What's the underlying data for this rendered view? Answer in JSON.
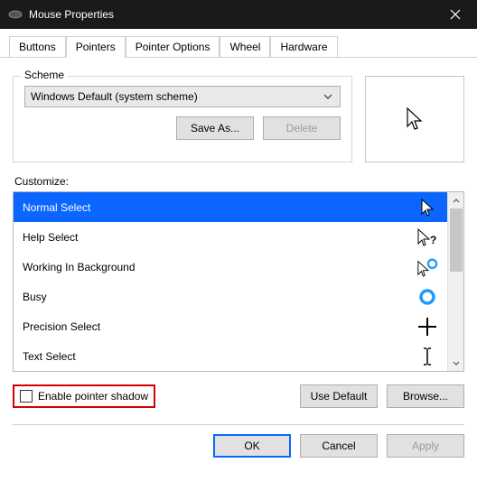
{
  "window": {
    "title": "Mouse Properties"
  },
  "tabs": {
    "buttons": "Buttons",
    "pointers": "Pointers",
    "pointer_options": "Pointer Options",
    "wheel": "Wheel",
    "hardware": "Hardware"
  },
  "scheme": {
    "legend": "Scheme",
    "selected": "Windows Default (system scheme)",
    "save_as": "Save As...",
    "delete": "Delete"
  },
  "customize_label": "Customize:",
  "cursors": {
    "normal_select": "Normal Select",
    "help_select": "Help Select",
    "working_bg": "Working In Background",
    "busy": "Busy",
    "precision": "Precision Select",
    "text": "Text Select"
  },
  "enable_shadow": "Enable pointer shadow",
  "use_default": "Use Default",
  "browse": "Browse...",
  "footer": {
    "ok": "OK",
    "cancel": "Cancel",
    "apply": "Apply"
  }
}
